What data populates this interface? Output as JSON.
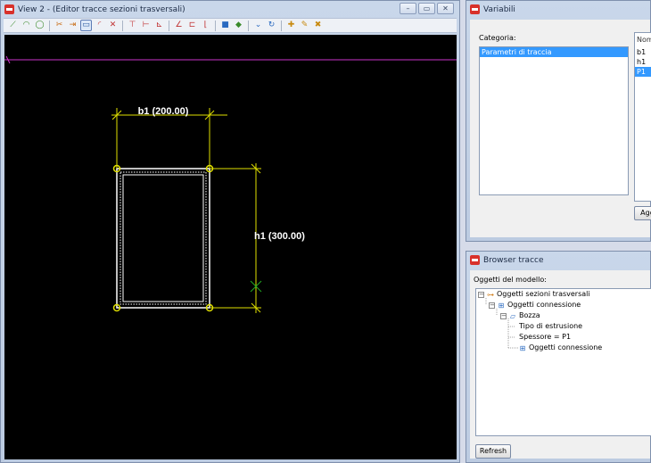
{
  "view_window": {
    "title": "View 2 - (Editor tracce sezioni  trasversali)",
    "buttons": [
      "–",
      "▭",
      "✕"
    ],
    "toolbar_icons": [
      "line-tool-icon",
      "arc-tool-icon",
      "circle-tool-icon",
      "trim-icon",
      "extend-icon",
      "select-rect-icon",
      "arc-3pt-icon",
      "delete-segments-icon",
      "hdim-icon",
      "vdim-icon",
      "aligned-dim-icon",
      "angle-icon",
      "chamfer-icon",
      "fillet-icon",
      "paint-icon",
      "layers-icon",
      "constraint-icon",
      "constraint-solve-icon",
      "variable-add-icon",
      "variable-edit-icon",
      "variable-delete-icon"
    ],
    "drawing": {
      "dim_b1_label": "b1 (200.00)",
      "dim_h1_label": "h1 (300.00)"
    }
  },
  "variabili": {
    "title": "Variabili",
    "categoria_label": "Categoria:",
    "categorie": [
      {
        "label": "Parametri di traccia",
        "selected": true
      }
    ],
    "nome_header": "Nom",
    "nomi": [
      {
        "label": "b1",
        "selected": false
      },
      {
        "label": "h1",
        "selected": false
      },
      {
        "label": "P1",
        "selected": true
      }
    ],
    "agg_button": "Agg"
  },
  "browser": {
    "title": "Browser tracce",
    "oggetti_label": "Oggetti del modello:",
    "tree": {
      "root": "Oggetti sezioni trasversali",
      "child1": "Oggetti connessione",
      "bozza": "Bozza",
      "tipo": "Tipo di estrusione",
      "spessore": "Spessore = P1",
      "oggetti2": "Oggetti connessione"
    },
    "refresh_button": "Refresh"
  },
  "colors": {
    "canvas_bg": "#000000",
    "profile_line": "#cc33cc",
    "dim_color": "#e0e000",
    "shape_color": "#ffffff",
    "selection": "#3399ff"
  }
}
